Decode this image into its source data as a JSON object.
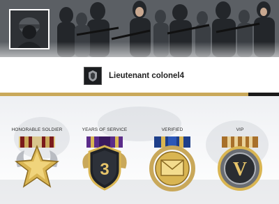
{
  "profile": {
    "rank_name": "Lieutenant colonel4"
  },
  "colors": {
    "accent_gold": "#c9a85a",
    "accent_dark": "#1a1a1a"
  },
  "medals": [
    {
      "label": "HONORABLE SOLDIER",
      "icon": "gold-star-medal-icon"
    },
    {
      "label": "YEARS OF SERVICE",
      "icon": "number-3-shield-medal-icon"
    },
    {
      "label": "VERIFIED",
      "icon": "envelope-medal-icon"
    },
    {
      "label": "VIP",
      "icon": "v-letter-medal-icon"
    }
  ],
  "medal_3_number": "3",
  "medal_4_letter": "V"
}
